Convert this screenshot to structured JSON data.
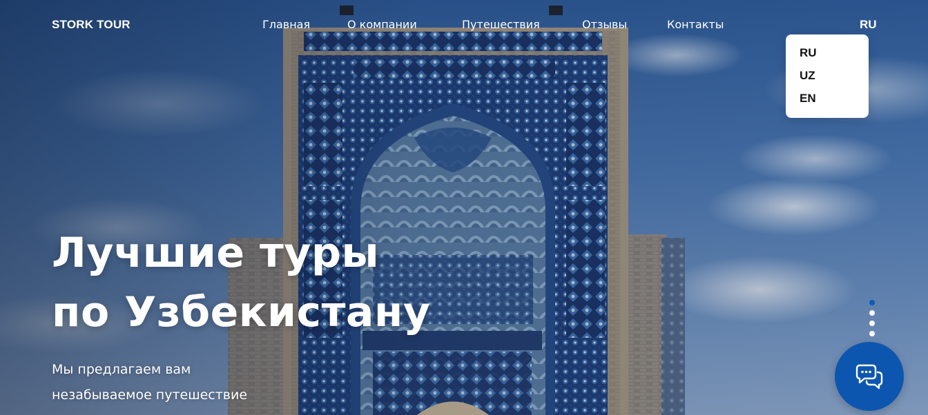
{
  "brand": {
    "logo": "STORK TOUR"
  },
  "nav": {
    "items": [
      {
        "label": "Главная"
      },
      {
        "label": "О компании"
      },
      {
        "label": "Путешествия"
      },
      {
        "label": "Отзывы"
      },
      {
        "label": "Контакты"
      }
    ]
  },
  "language": {
    "current": "RU",
    "options": [
      "RU",
      "UZ",
      "EN"
    ]
  },
  "hero": {
    "title_line1": "Лучшие туры",
    "title_line2": "по Узбекистану",
    "subtitle_line1": "Мы предлагаем вам",
    "subtitle_line2": "незабываемое путешествие"
  },
  "slider": {
    "count": 4,
    "active_index": 0
  },
  "chat": {
    "icon": "chat-bubbles-icon"
  },
  "colors": {
    "accent": "#0d56b0",
    "active_dot": "#0d5bb8",
    "text": "#ffffff",
    "dropdown_bg": "#ffffff"
  }
}
